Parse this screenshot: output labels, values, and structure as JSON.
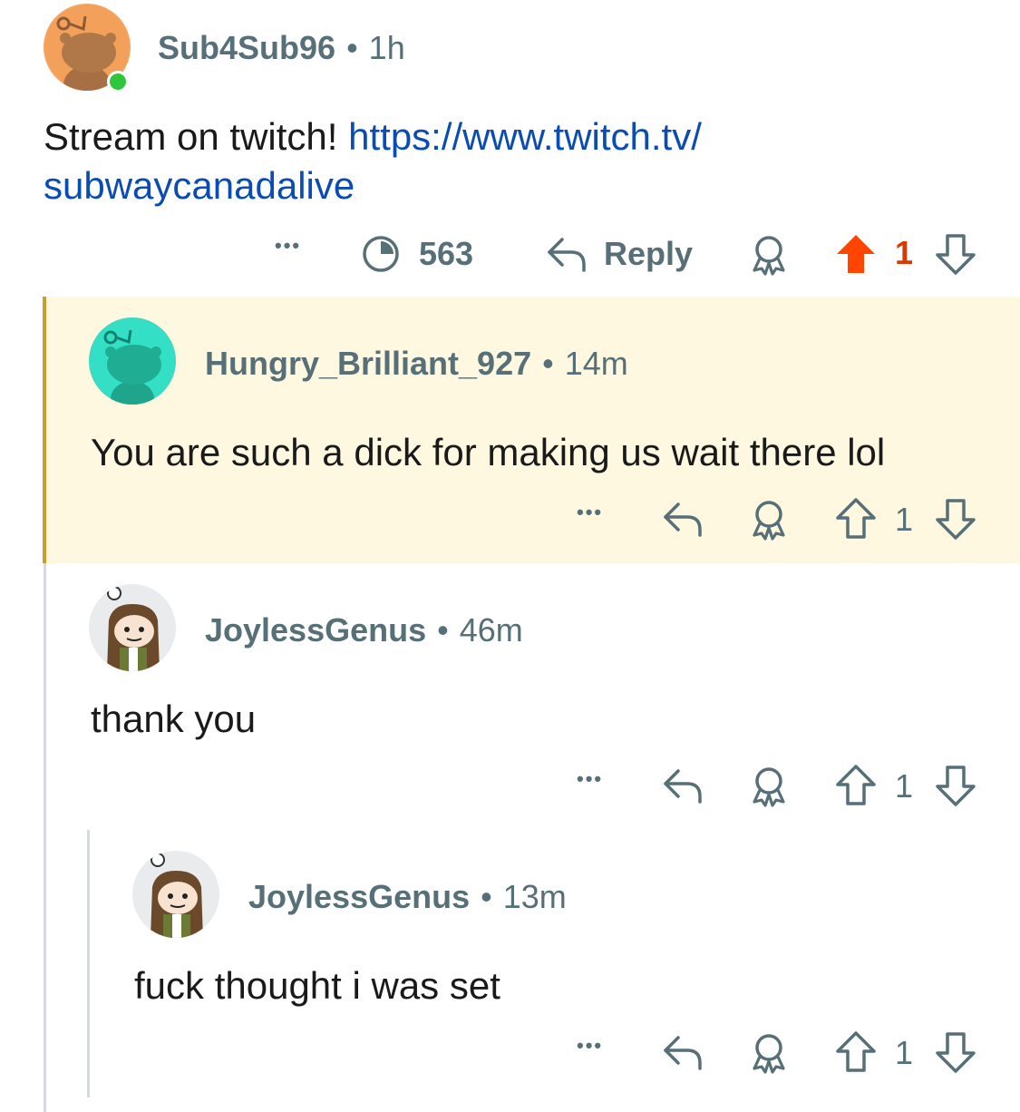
{
  "comments": [
    {
      "username": "Sub4Sub96",
      "separator": "•",
      "age": "1h",
      "text_prefix": "Stream on twitch! ",
      "link_line1": "https://www.twitch.tv/",
      "link_line2": "subwaycanadalive",
      "more": "•••",
      "views": "563",
      "reply_label": "Reply",
      "votes": "1",
      "online": true,
      "upvoted": true
    },
    {
      "username": "Hungry_Brilliant_927",
      "separator": "•",
      "age": "14m",
      "text": "You are such a dick for making us wait there lol",
      "more": "•••",
      "votes": "1",
      "highlighted": true
    },
    {
      "username": "JoylessGenus",
      "separator": "•",
      "age": "46m",
      "text": "thank you",
      "more": "•••",
      "votes": "1"
    },
    {
      "username": "JoylessGenus",
      "separator": "•",
      "age": "13m",
      "text": "fuck thought i was set",
      "more": "•••",
      "votes": "1"
    }
  ],
  "colors": {
    "upvote_active": "#ff4500",
    "link": "#0a4cb3",
    "highlight_bg": "#fef8e0",
    "highlight_border": "#c99c2e",
    "meta_text": "#576f76"
  }
}
